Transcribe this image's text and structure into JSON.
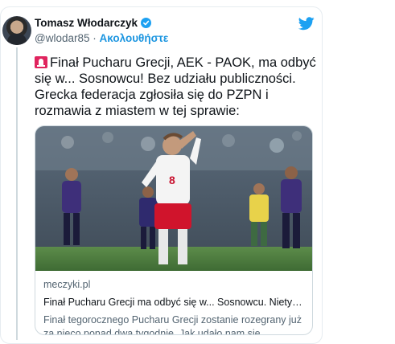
{
  "tweet": {
    "author_name": "Tomasz Włodarczyk",
    "handle": "@wlodar85",
    "separator": "·",
    "follow_label": "Ακολουθήστε",
    "text": "Finał Pucharu Grecji, AEK - PAOK, ma odbyć się w... Sosnowcu! Bez udziału publiczności. Grecka federacja zgłosiła się do PZPN i rozmawia z miastem w tej sprawie:",
    "verified": true,
    "icons": {
      "bird": "twitter-bird-icon",
      "verified": "verified-badge-icon",
      "emoji": "rotating-light-emoji"
    },
    "colors": {
      "accent": "#1da1f2",
      "link": "#1b95e0",
      "text": "#0f1419",
      "muted": "#536471"
    }
  },
  "link_card": {
    "domain": "meczyki.pl",
    "title": "Finał Pucharu Grecji ma odbyć się w... Sosnowcu. Nietypowy ...",
    "description": "Finał tegorocznego Pucharu Grecji zostanie rozegrany już za nieco ponad dwa tygodnie. Jak udało nam się dowiedzieć, ...",
    "photo": {
      "player_number": "8"
    }
  }
}
